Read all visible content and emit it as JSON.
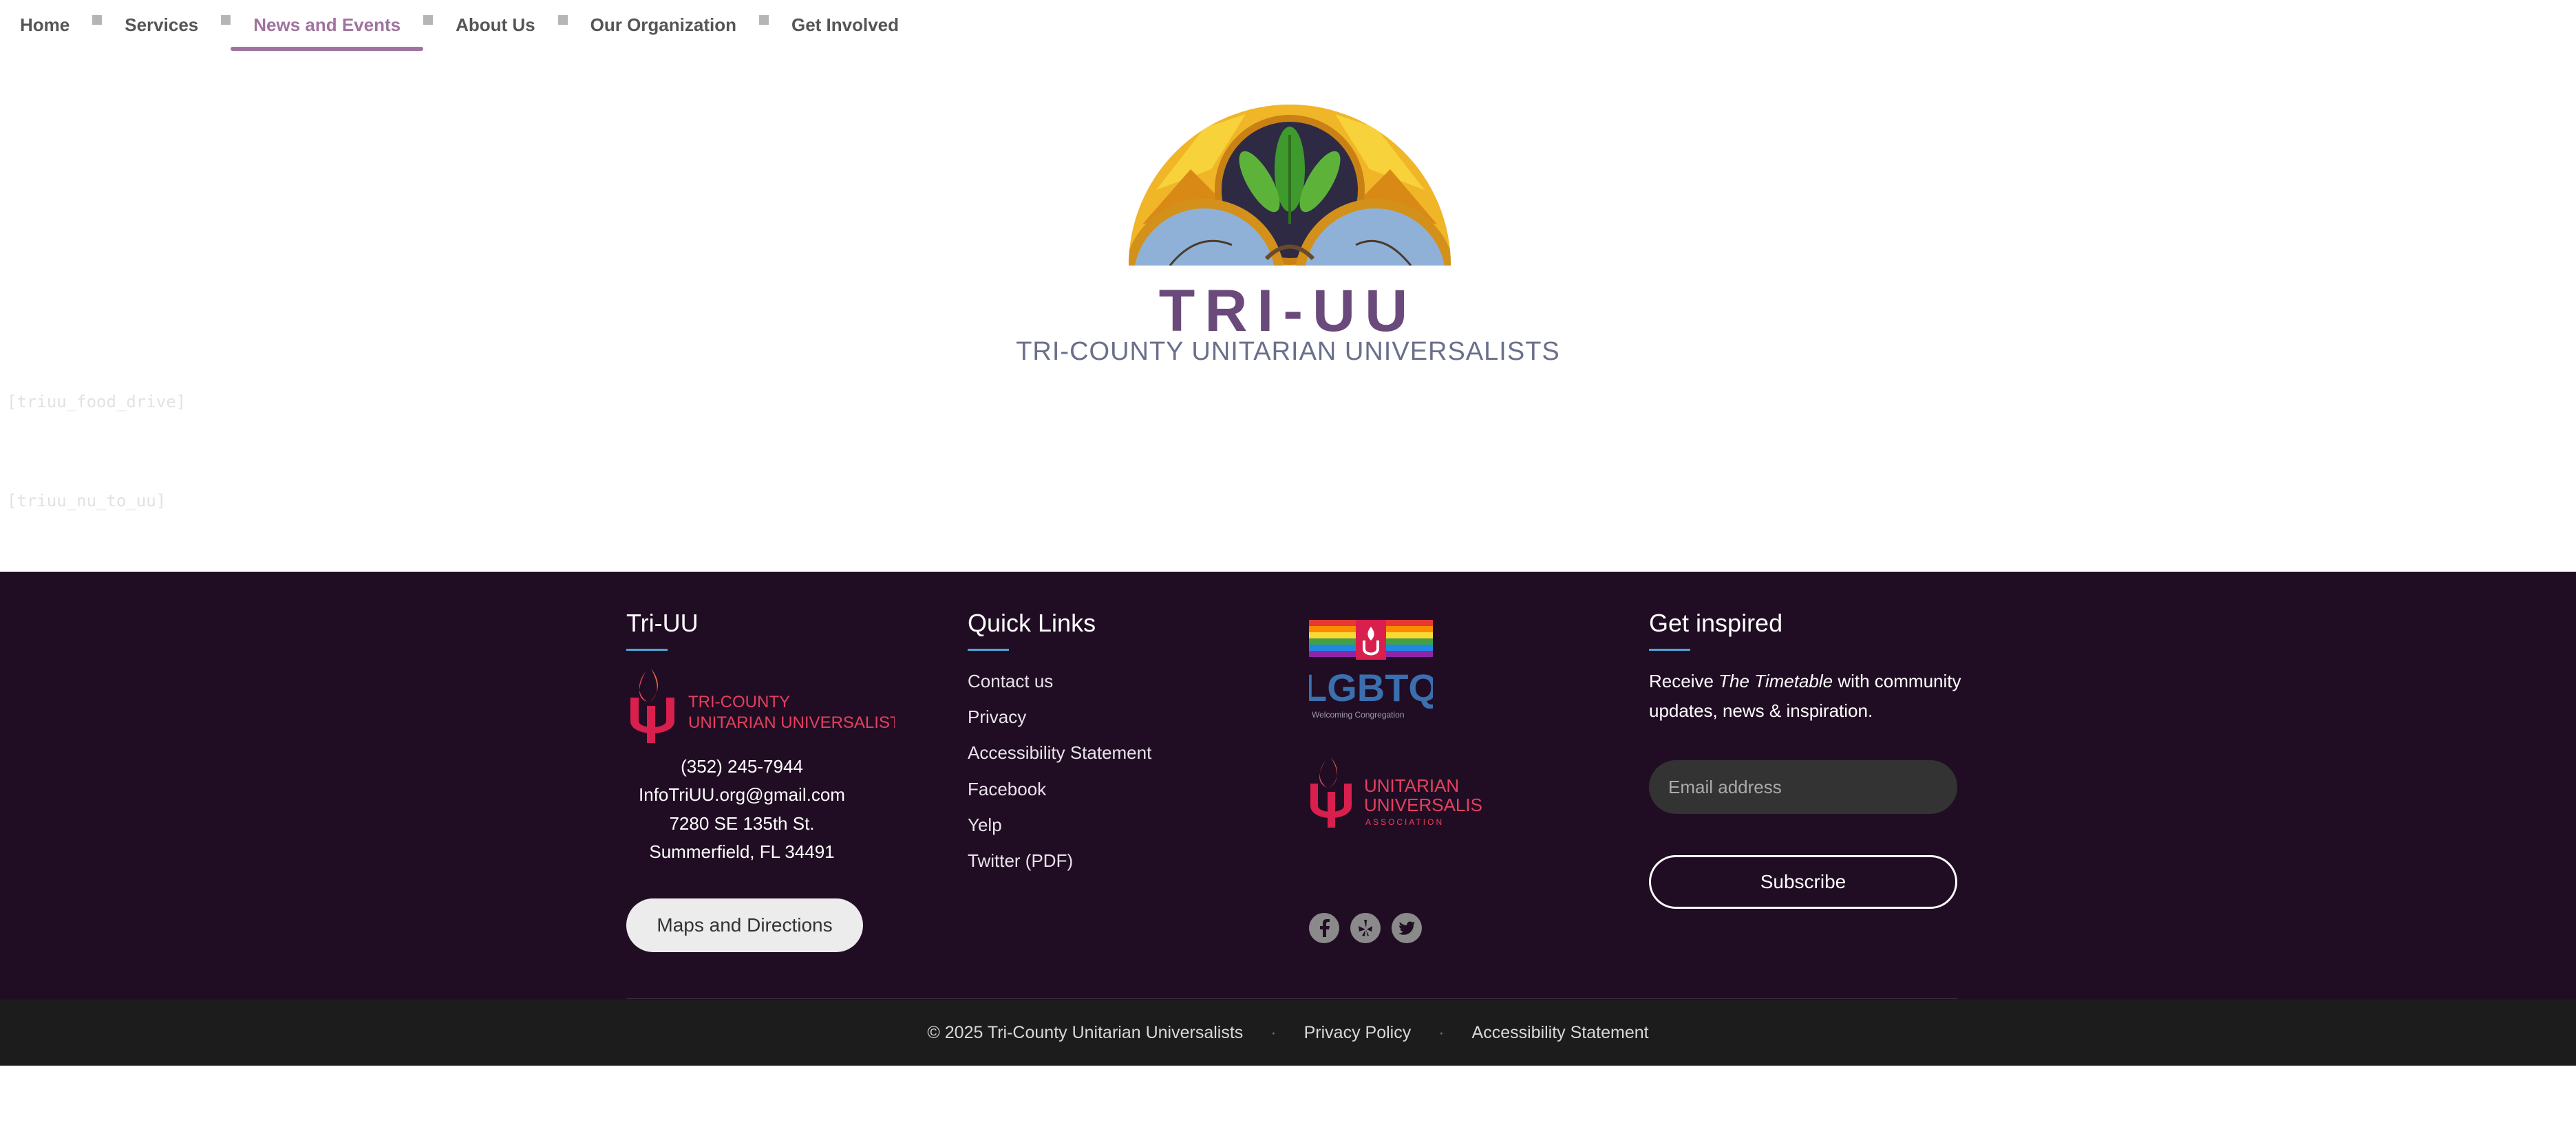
{
  "nav": {
    "items": [
      {
        "label": "Home",
        "active": false
      },
      {
        "label": "Services",
        "active": false
      },
      {
        "label": "News and Events",
        "active": true
      },
      {
        "label": "About Us",
        "active": false
      },
      {
        "label": "Our Organization",
        "active": false
      },
      {
        "label": "Get Involved",
        "active": false
      }
    ],
    "active_color": "#a0739f"
  },
  "header": {
    "title": "TRI-UU",
    "subtitle": "TRI-COUNTY UNITARIAN UNIVERSALISTS"
  },
  "shortcodes": [
    "[triuu_food_drive]",
    "[triuu_nu_to_uu]"
  ],
  "footer": {
    "about": {
      "title": "Tri-UU",
      "logo_text_line1": "TRI-COUNTY",
      "logo_text_line2": "UNITARIAN UNIVERSALISTS",
      "phone": "(352) 245-7944",
      "email": "InfoTriUU.org@gmail.com",
      "address1": "7280 SE 135th St.",
      "address2": "Summerfield, FL 34491",
      "maps_button": "Maps and Directions"
    },
    "quick_links": {
      "title": "Quick Links",
      "links": [
        "Contact us",
        "Privacy",
        "Accessibility Statement",
        "Facebook",
        "Yelp",
        "Twitter (PDF)"
      ]
    },
    "badges": {
      "lgbtq_text": "LGBTQ",
      "lgbtq_caption": "Welcoming Congregation",
      "uua_line1": "UNITARIAN",
      "uua_line2": "UNIVERSALIST",
      "uua_line3": "ASSOCIATION",
      "social": [
        "facebook-icon",
        "yelp-icon",
        "twitter-icon"
      ]
    },
    "newsletter": {
      "title": "Get inspired",
      "text_before": "Receive ",
      "text_em": "The Timetable",
      "text_after": " with community updates, news & inspiration.",
      "email_placeholder": "Email address",
      "subscribe_label": "Subscribe"
    },
    "background": "#210d23",
    "accent": "#4aa6d6"
  },
  "bottom_bar": {
    "copyright": "© 2025 Tri-County Unitarian Universalists",
    "separator": "·",
    "privacy": "Privacy Policy",
    "accessibility": "Accessibility Statement"
  }
}
